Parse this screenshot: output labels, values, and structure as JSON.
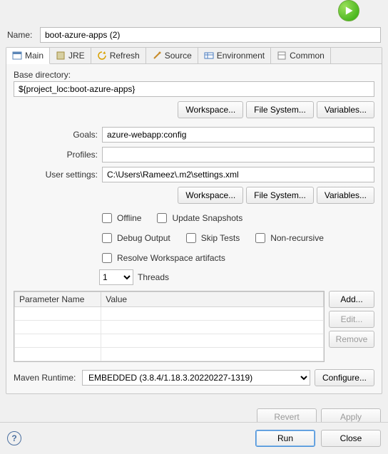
{
  "name_label": "Name:",
  "name_value": "boot-azure-apps (2)",
  "tabs": {
    "main": "Main",
    "jre": "JRE",
    "refresh": "Refresh",
    "source": "Source",
    "environment": "Environment",
    "common": "Common"
  },
  "base_dir": {
    "label": "Base directory:",
    "value": "${project_loc:boot-azure-apps}"
  },
  "buttons": {
    "workspace": "Workspace...",
    "filesystem": "File System...",
    "variables": "Variables...",
    "add": "Add...",
    "edit": "Edit...",
    "remove": "Remove",
    "configure": "Configure...",
    "revert": "Revert",
    "apply": "Apply",
    "run": "Run",
    "close": "Close"
  },
  "fields": {
    "goals_label": "Goals:",
    "goals_value": "azure-webapp:config",
    "profiles_label": "Profiles:",
    "profiles_value": "",
    "usersettings_label": "User settings:",
    "usersettings_value": "C:\\Users\\Rameez\\.m2\\settings.xml"
  },
  "checks": {
    "offline": "Offline",
    "update_snapshots": "Update Snapshots",
    "debug_output": "Debug Output",
    "skip_tests": "Skip Tests",
    "non_recursive": "Non-recursive",
    "resolve_ws": "Resolve Workspace artifacts"
  },
  "threads": {
    "value": "1",
    "label": "Threads"
  },
  "params": {
    "col_name": "Parameter Name",
    "col_value": "Value"
  },
  "runtime": {
    "label": "Maven Runtime:",
    "value": "EMBEDDED (3.8.4/1.18.3.20220227-1319)"
  }
}
